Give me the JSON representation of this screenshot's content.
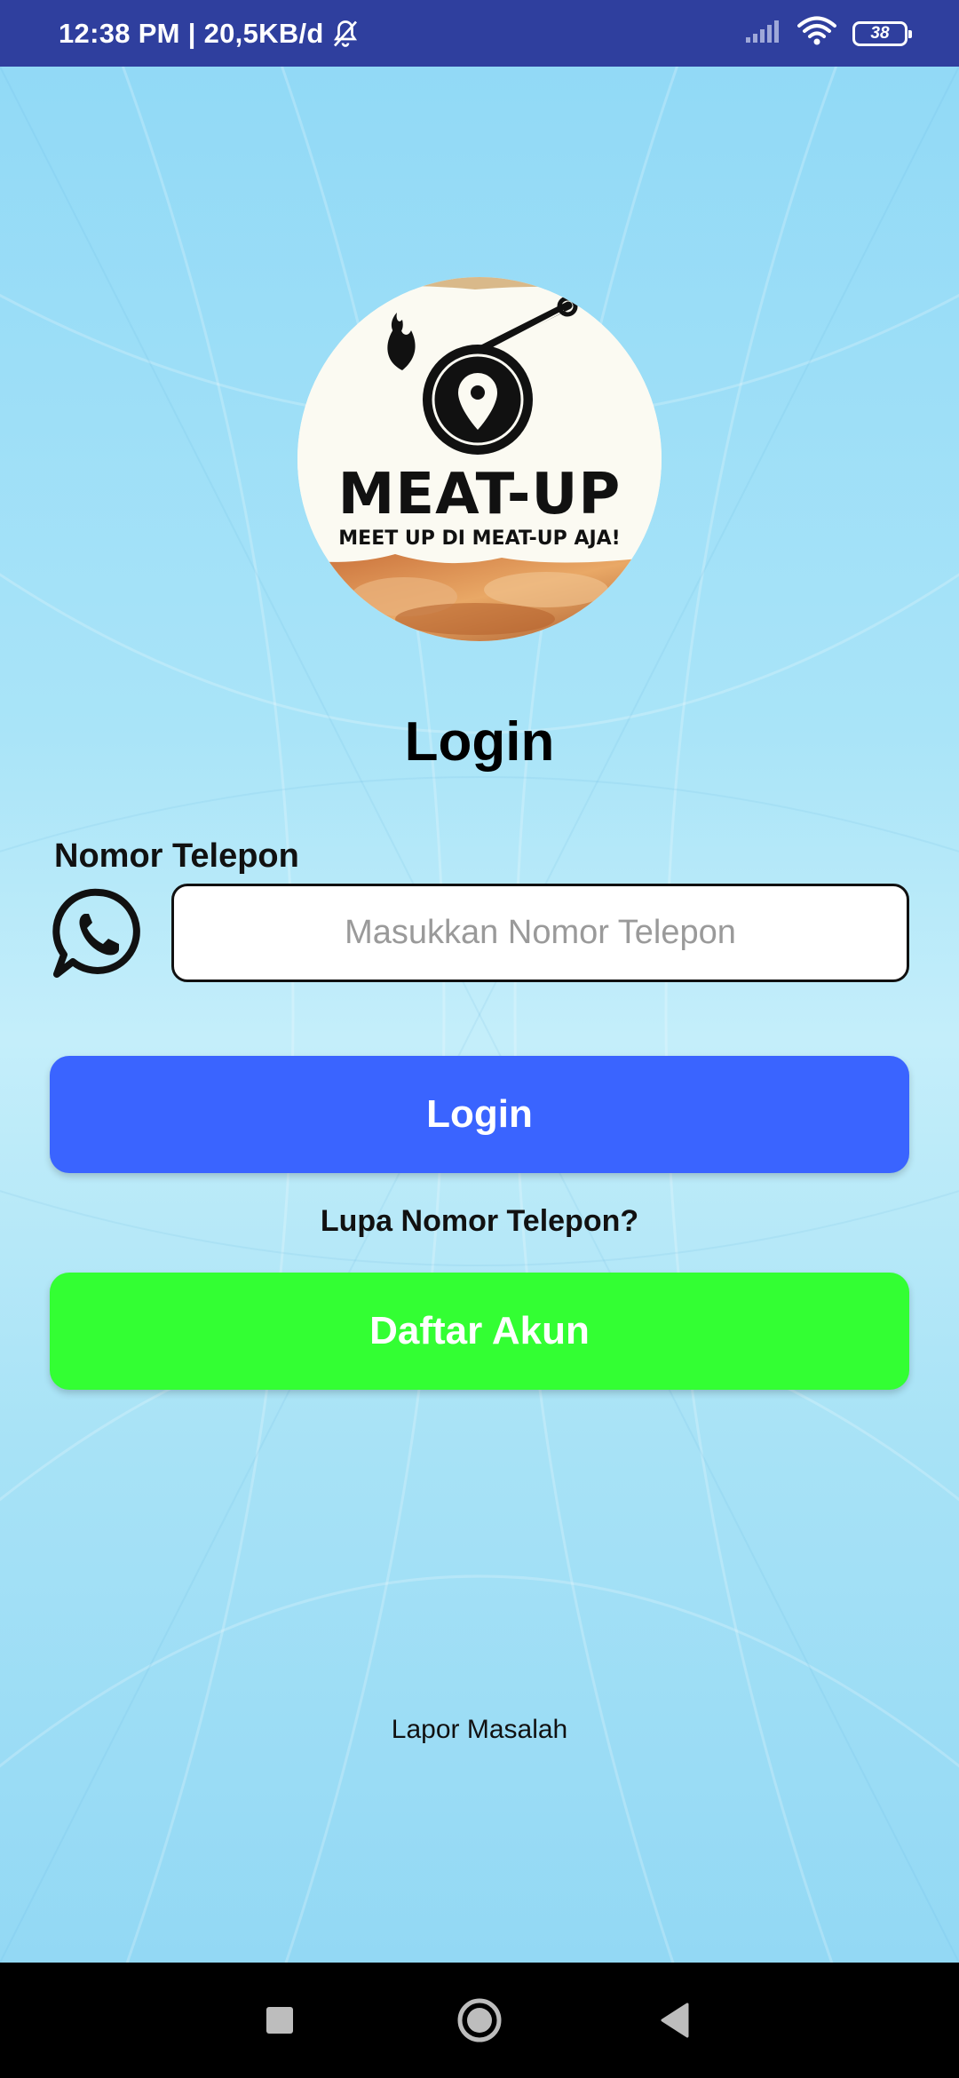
{
  "status_bar": {
    "time_and_speed": "12:38 PM | 20,5KB/d",
    "battery_level": "38"
  },
  "logo": {
    "brand_name": "MEAT-UP",
    "tagline": "MEET UP DI MEAT-UP AJA!"
  },
  "login": {
    "title": "Login",
    "phone_label": "Nomor Telepon",
    "phone_placeholder": "Masukkan Nomor Telepon",
    "phone_value": "",
    "login_button": "Login",
    "forgot_link": "Lupa Nomor Telepon?",
    "register_button": "Daftar Akun",
    "report_link": "Lapor Masalah"
  },
  "icons": {
    "status": [
      "mute-icon",
      "signal-icon",
      "wifi-icon",
      "battery-icon"
    ],
    "logo": [
      "flame-icon",
      "skillet-icon",
      "location-pin-icon"
    ],
    "form": [
      "whatsapp-icon"
    ],
    "navigation": [
      "recents-icon",
      "home-icon",
      "back-icon"
    ]
  },
  "colors": {
    "status_bar": "#2f3f9e",
    "login_button": "#3a64ff",
    "register_button": "#33ff33",
    "background": "#a9e4f8",
    "nav_bar": "#000000"
  }
}
